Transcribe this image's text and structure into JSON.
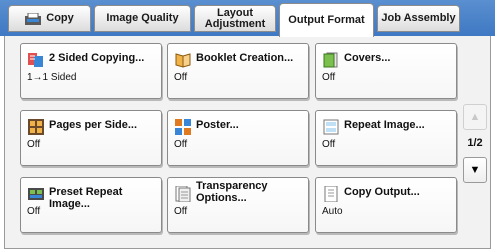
{
  "tabs": [
    {
      "label": "Copy",
      "icon": "copy-icon",
      "active": false
    },
    {
      "label": "Image Quality",
      "active": false
    },
    {
      "label": "Layout\nAdjustment",
      "active": false
    },
    {
      "label": "Output Format",
      "active": true
    },
    {
      "label": "Job Assembly",
      "active": false
    }
  ],
  "features": [
    {
      "title": "2 Sided Copying...",
      "value": "1→1 Sided",
      "icon": "two-sided-icon"
    },
    {
      "title": "Booklet Creation...",
      "value": "Off",
      "icon": "booklet-icon"
    },
    {
      "title": "Covers...",
      "value": "Off",
      "icon": "covers-icon"
    },
    {
      "title": "Pages per Side...",
      "value": "Off",
      "icon": "pages-per-side-icon"
    },
    {
      "title": "Poster...",
      "value": "Off",
      "icon": "poster-icon"
    },
    {
      "title": "Repeat Image...",
      "value": "Off",
      "icon": "repeat-image-icon"
    },
    {
      "title": "Preset Repeat Image...",
      "value": "Off",
      "icon": "preset-repeat-image-icon"
    },
    {
      "title": "Transparency\nOptions...",
      "value": "Off",
      "icon": "transparency-icon"
    },
    {
      "title": "Copy Output...",
      "value": "Auto",
      "icon": "copy-output-icon"
    }
  ],
  "pager": {
    "label": "1/2",
    "up_icon": "arrow-up-icon",
    "down_icon": "arrow-down-icon"
  }
}
